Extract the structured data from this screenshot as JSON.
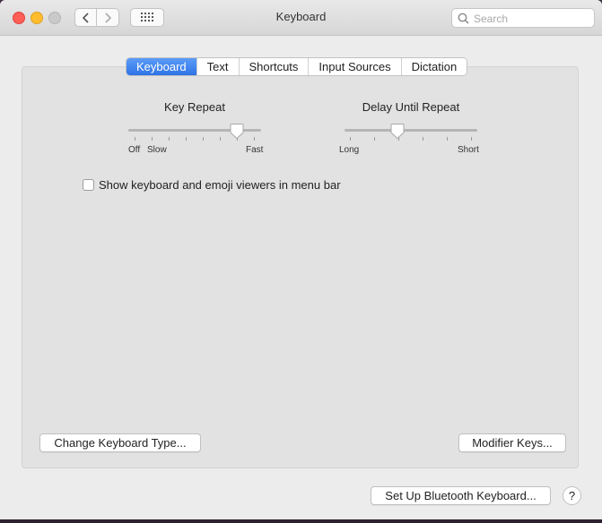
{
  "window": {
    "title": "Keyboard"
  },
  "search": {
    "placeholder": "Search"
  },
  "tabs": [
    {
      "label": "Keyboard",
      "active": true
    },
    {
      "label": "Text",
      "active": false
    },
    {
      "label": "Shortcuts",
      "active": false
    },
    {
      "label": "Input Sources",
      "active": false
    },
    {
      "label": "Dictation",
      "active": false
    }
  ],
  "key_repeat": {
    "title": "Key Repeat",
    "label_off": "Off",
    "label_slow": "Slow",
    "label_fast": "Fast",
    "value_fraction": 0.82
  },
  "delay_until_repeat": {
    "title": "Delay Until Repeat",
    "label_long": "Long",
    "label_short": "Short",
    "value_fraction": 0.4
  },
  "options": {
    "emoji_viewers_label": "Show keyboard and emoji viewers in menu bar",
    "emoji_viewers_checked": false
  },
  "buttons": {
    "change_keyboard_type": "Change Keyboard Type...",
    "modifier_keys": "Modifier Keys...",
    "bluetooth_keyboard": "Set Up Bluetooth Keyboard...",
    "help": "?"
  },
  "icons": {
    "back": "chevron-left-icon",
    "forward": "chevron-right-icon",
    "show_all": "grid-icon",
    "search": "search-icon"
  },
  "colors": {
    "accent": "#2f73e6",
    "close": "#fe5f57",
    "minimize": "#febc2e",
    "zoom_inactive": "#c9c9c9"
  }
}
